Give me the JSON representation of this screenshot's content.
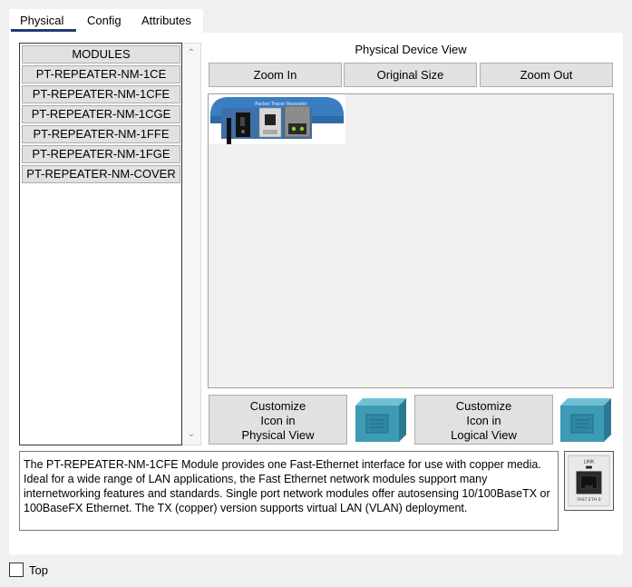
{
  "tabs": [
    "Physical",
    "Config",
    "Attributes"
  ],
  "modules": {
    "header": "MODULES",
    "items": [
      "PT-REPEATER-NM-1CE",
      "PT-REPEATER-NM-1CFE",
      "PT-REPEATER-NM-1CGE",
      "PT-REPEATER-NM-1FFE",
      "PT-REPEATER-NM-1FGE",
      "PT-REPEATER-NM-COVER"
    ]
  },
  "device_view": {
    "title": "Physical Device View",
    "zoom_in": "Zoom In",
    "original_size": "Original Size",
    "zoom_out": "Zoom Out",
    "device_label": "Packet Tracer Repeater"
  },
  "customize": {
    "physical": [
      "Customize",
      "Icon in",
      "Physical View"
    ],
    "logical": [
      "Customize",
      "Icon in",
      "Logical View"
    ]
  },
  "description": "The PT-REPEATER-NM-1CFE Module provides one Fast-Ethernet interface for use with copper media. Ideal for a wide range of LAN applications, the Fast Ethernet network modules support many internetworking features and standards. Single port network modules offer autosensing 10/100BaseTX or 100BaseFX Ethernet. The TX (copper) version supports virtual LAN (VLAN) deployment.",
  "module_image": {
    "link_label": "LINK",
    "port_label": "FAST ETH 0"
  },
  "top_checkbox": {
    "label": "Top",
    "checked": false
  },
  "colors": {
    "accent": "#1f3b73",
    "cube": "#3d9bb5"
  }
}
